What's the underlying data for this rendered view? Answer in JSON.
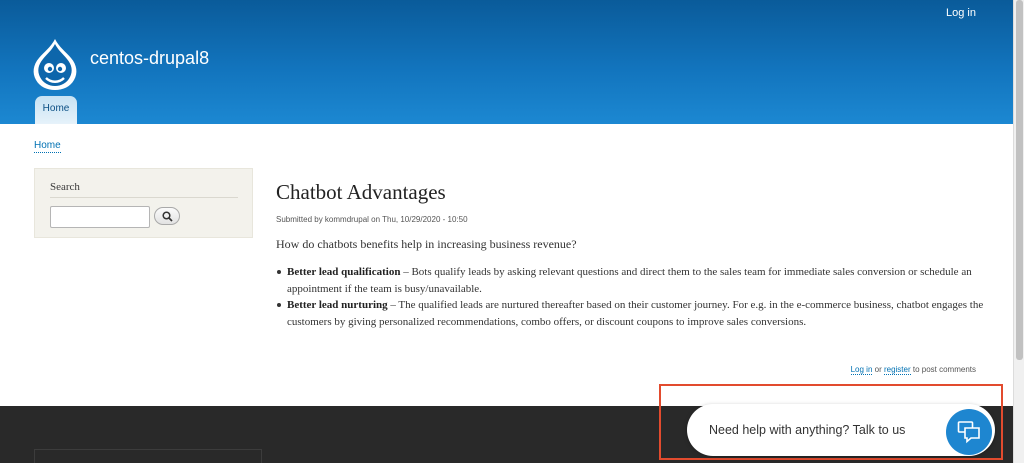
{
  "header": {
    "login_label": "Log in",
    "site_name": "centos-drupal8",
    "logo_icon": "drupal-drop-icon",
    "tab_home": "Home",
    "color_header": "#1274bd"
  },
  "breadcrumb": {
    "home": "Home"
  },
  "sidebar": {
    "title": "Search",
    "search_value": "",
    "search_icon": "search-icon"
  },
  "article": {
    "title": "Chatbot Advantages",
    "submitted": "Submitted by kommdrupal on Thu, 10/29/2020 - 10:50",
    "intro": "How do chatbots benefits help in increasing business revenue?",
    "bullets": [
      {
        "bold": "Better lead qualification",
        "text": " – Bots qualify leads by asking relevant questions and direct them to the sales team for immediate sales conversion or schedule an appointment if the team is busy/unavailable."
      },
      {
        "bold": "Better lead nurturing",
        "text": " – The qualified leads are nurtured thereafter based on their customer journey. For e.g. in the e-commerce business, chatbot engages the customers by giving personalized recommendations, combo offers, or discount coupons to improve sales conversions."
      }
    ]
  },
  "comments": {
    "login_link": "Log in",
    "or": " or ",
    "register_link": "register",
    "suffix": " to post comments"
  },
  "chat_widget": {
    "prompt": "Need help with anything? Talk to us",
    "icon": "chat-bubbles-icon",
    "color_button": "#1e86d0",
    "color_highlight": "#e24b2e"
  }
}
